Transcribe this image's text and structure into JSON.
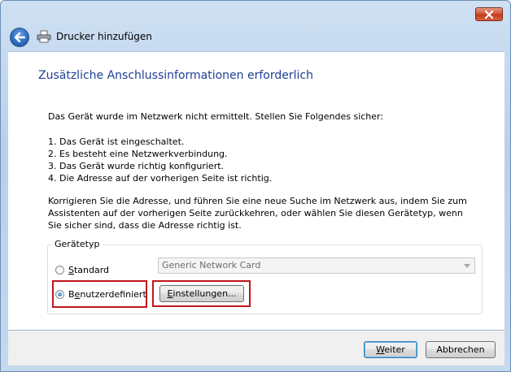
{
  "window": {
    "title": "Drucker hinzufügen"
  },
  "page": {
    "heading": "Zusätzliche Anschlussinformationen erforderlich",
    "intro": "Das Gerät wurde im Netzwerk nicht ermittelt. Stellen Sie Folgendes sicher:",
    "checklist": [
      "1.  Das Gerät ist eingeschaltet.",
      "2.  Es besteht eine Netzwerkverbindung.",
      "3.  Das Gerät wurde richtig konfiguriert.",
      "4.  Die Adresse auf der vorherigen Seite ist richtig."
    ],
    "instructions": "Korrigieren Sie die Adresse, und führen Sie eine neue Suche im Netzwerk aus, indem Sie zum Assistenten auf der vorherigen Seite zurückkehren, oder wählen Sie diesen Gerätetyp, wenn Sie sicher sind, dass die Adresse richtig ist."
  },
  "device_type": {
    "legend": "Gerätetyp",
    "standard": {
      "label_mnemonic": "S",
      "label_rest": "tandard",
      "selected": false
    },
    "custom": {
      "label_prefix": "B",
      "label_mnemonic": "e",
      "label_rest": "nutzerdefiniert",
      "selected": true
    },
    "combo_value": "Generic Network Card",
    "settings_button": {
      "label_mnemonic": "E",
      "label_rest": "instellungen..."
    }
  },
  "footer": {
    "next": {
      "label_mnemonic": "W",
      "label_rest": "eiter"
    },
    "cancel": "Abbrechen"
  },
  "colors": {
    "heading": "#1e3f95",
    "highlight": "#c0161c",
    "close_button": "#c23b1c"
  },
  "icons": {
    "close": "close-icon",
    "back": "back-arrow-icon",
    "printer": "printer-icon",
    "dropdown": "chevron-down-icon"
  }
}
